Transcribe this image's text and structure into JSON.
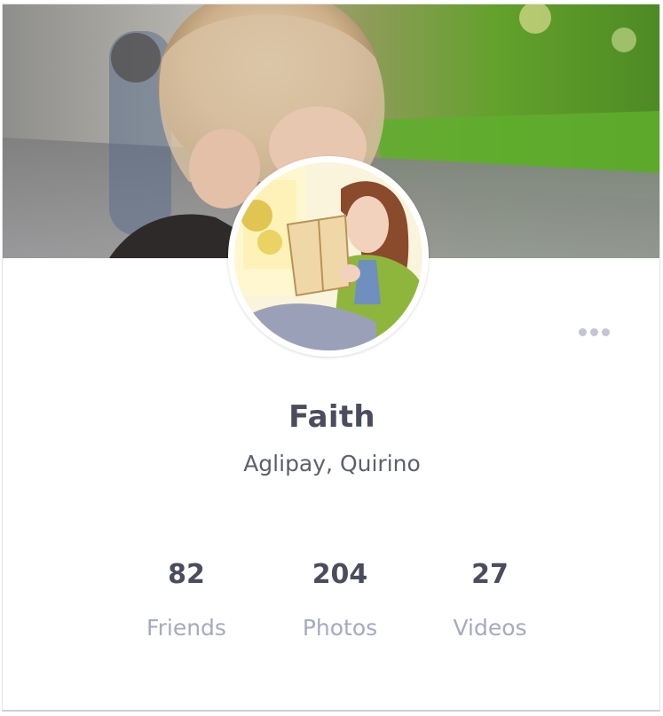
{
  "profile": {
    "name": "Faith",
    "location": "Aglipay, Quirino"
  },
  "stats": [
    {
      "value": "82",
      "label": "Friends"
    },
    {
      "value": "204",
      "label": "Photos"
    },
    {
      "value": "27",
      "label": "Videos"
    }
  ],
  "menu": {
    "icon": "more-horizontal-icon"
  },
  "colors": {
    "name_text": "#4b4d5e",
    "location_text": "#5d5f70",
    "stat_label": "#a7a9c0",
    "menu_dots": "#c3c5d4"
  }
}
